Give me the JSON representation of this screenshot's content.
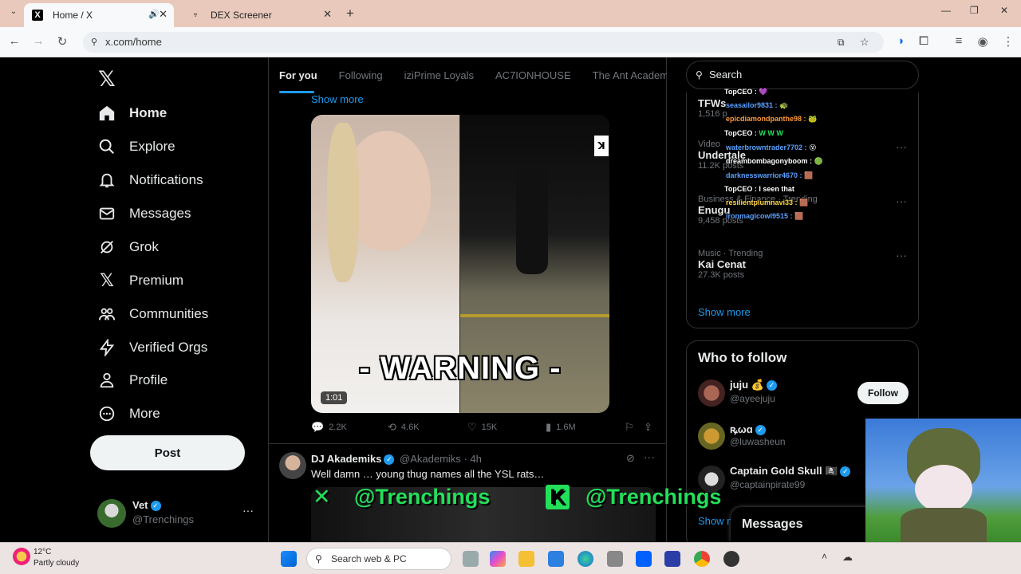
{
  "browser": {
    "tabs": [
      {
        "title": "Home / X",
        "icon": "x-logo-icon",
        "active": true
      },
      {
        "title": "DEX Screener",
        "icon": "dexscreener-icon",
        "active": false
      }
    ],
    "url": "x.com/home"
  },
  "nav": {
    "items": [
      {
        "label": "Home",
        "icon": "home-icon"
      },
      {
        "label": "Explore",
        "icon": "search-icon"
      },
      {
        "label": "Notifications",
        "icon": "bell-icon"
      },
      {
        "label": "Messages",
        "icon": "envelope-icon"
      },
      {
        "label": "Grok",
        "icon": "grok-icon"
      },
      {
        "label": "Premium",
        "icon": "x-logo-icon"
      },
      {
        "label": "Communities",
        "icon": "people-icon"
      },
      {
        "label": "Verified Orgs",
        "icon": "lightning-icon"
      },
      {
        "label": "Profile",
        "icon": "person-icon"
      },
      {
        "label": "More",
        "icon": "more-circle-icon"
      }
    ],
    "post_label": "Post",
    "user": {
      "name": "Vet",
      "handle": "@Trenchings"
    }
  },
  "feed": {
    "tabs": [
      "For you",
      "Following",
      "iziPrime Loyals",
      "AC7IONHOUSE",
      "The Ant Academy"
    ],
    "show_more": "Show more",
    "video": {
      "overlay_text": "- WARNING -",
      "duration": "1:01"
    },
    "actions": {
      "replies": "2.2K",
      "reposts": "4.6K",
      "likes": "15K",
      "views": "1.6M"
    },
    "tweet2": {
      "name": "DJ Akademiks",
      "handle": "@Akademiks",
      "time": "· 4h",
      "text": "Well damn … young thug names all the YSL rats…"
    }
  },
  "watermark": {
    "left": "@Trenchings",
    "right": "@Trenchings"
  },
  "chat": [
    {
      "user": "TopCEO :",
      "msg": "💜",
      "color": "#ffffff"
    },
    {
      "user": "seasailor9831 :",
      "msg": "🐢",
      "color": "#5aa0ff"
    },
    {
      "user": "epicdiamondpanthe98 :",
      "msg": "🐸",
      "color": "#ff9a3c"
    },
    {
      "user": "TopCEO :",
      "msg": "W W W",
      "color": "#ffffff"
    },
    {
      "user": "waterbrowntrader7702 :",
      "msg": "😵",
      "color": "#5aa0ff"
    },
    {
      "user": "dreambombagonyboom :",
      "msg": "🟢",
      "color": "#ffffff"
    },
    {
      "user": "darknesswarrior4670 :",
      "msg": "🟫",
      "color": "#5aa0ff"
    },
    {
      "user": "TopCEO :",
      "msg": "I seen that",
      "color": "#ffffff"
    },
    {
      "user": "resilientplumnavi33 :",
      "msg": "🟫",
      "color": "#ffd84a"
    },
    {
      "user": "ironmagicowl9515 :",
      "msg": "🟫",
      "color": "#5aa0ff"
    }
  ],
  "sidebar": {
    "search_placeholder": "Search",
    "trends": [
      {
        "meta": "",
        "name": "TFWs",
        "posts": "1,516 p"
      },
      {
        "meta": "Video",
        "name": "Undertale",
        "posts": "11.2K posts"
      },
      {
        "meta": "Business & Finance · Trending",
        "name": "Enugu",
        "posts": "9,458 posts"
      },
      {
        "meta": "Music · Trending",
        "name": "Kai Cenat",
        "posts": "27.3K posts"
      }
    ],
    "trends_show_more": "Show more",
    "who_to_follow_title": "Who to follow",
    "follow_label": "Follow",
    "who_to_follow": [
      {
        "name": "juju 💰",
        "handle": "@ayeejuju"
      },
      {
        "name": "ꝶωɑ",
        "handle": "@luwasheun"
      },
      {
        "name": "Captain Gold Skull 🏴‍☠️",
        "handle": "@captainpirate99"
      }
    ],
    "who_show_more": "Show m",
    "messages_label": "Messages"
  },
  "taskbar": {
    "weather_temp": "12°C",
    "weather_desc": "Partly cloudy",
    "search_label": "Search web & PC"
  },
  "colors": {
    "accent": "#1d9bf0",
    "watermark": "#22e05a",
    "tabbar": "#e9c9bc"
  }
}
